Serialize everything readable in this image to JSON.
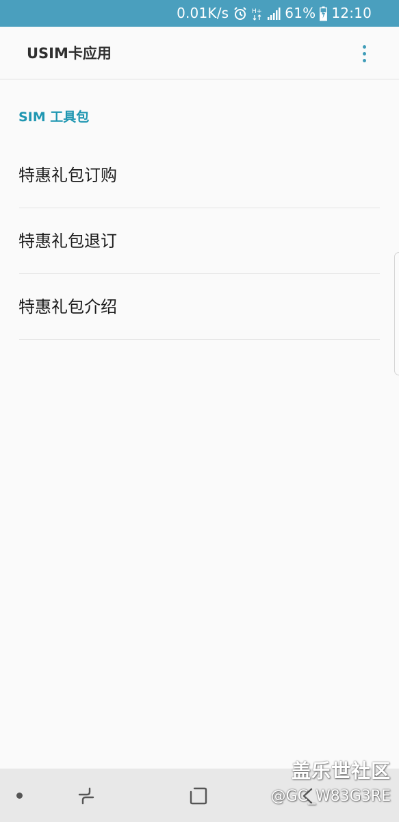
{
  "status_bar": {
    "speed": "0.01K/s",
    "network": "H+",
    "battery": "61%",
    "time": "12:10"
  },
  "app_bar": {
    "title": "USIM卡应用"
  },
  "section": {
    "title": "SIM 工具包"
  },
  "list": {
    "items": [
      {
        "label": "特惠礼包订购"
      },
      {
        "label": "特惠礼包退订"
      },
      {
        "label": "特惠礼包介绍"
      }
    ]
  },
  "watermark": {
    "line1": "盖乐世社区",
    "line2": "@GC_W83G3RE"
  },
  "colors": {
    "status_bar_bg": "#4a9fbe",
    "accent": "#1e96b1",
    "background": "#fafafa",
    "nav_bar_bg": "#e8e8e8"
  }
}
